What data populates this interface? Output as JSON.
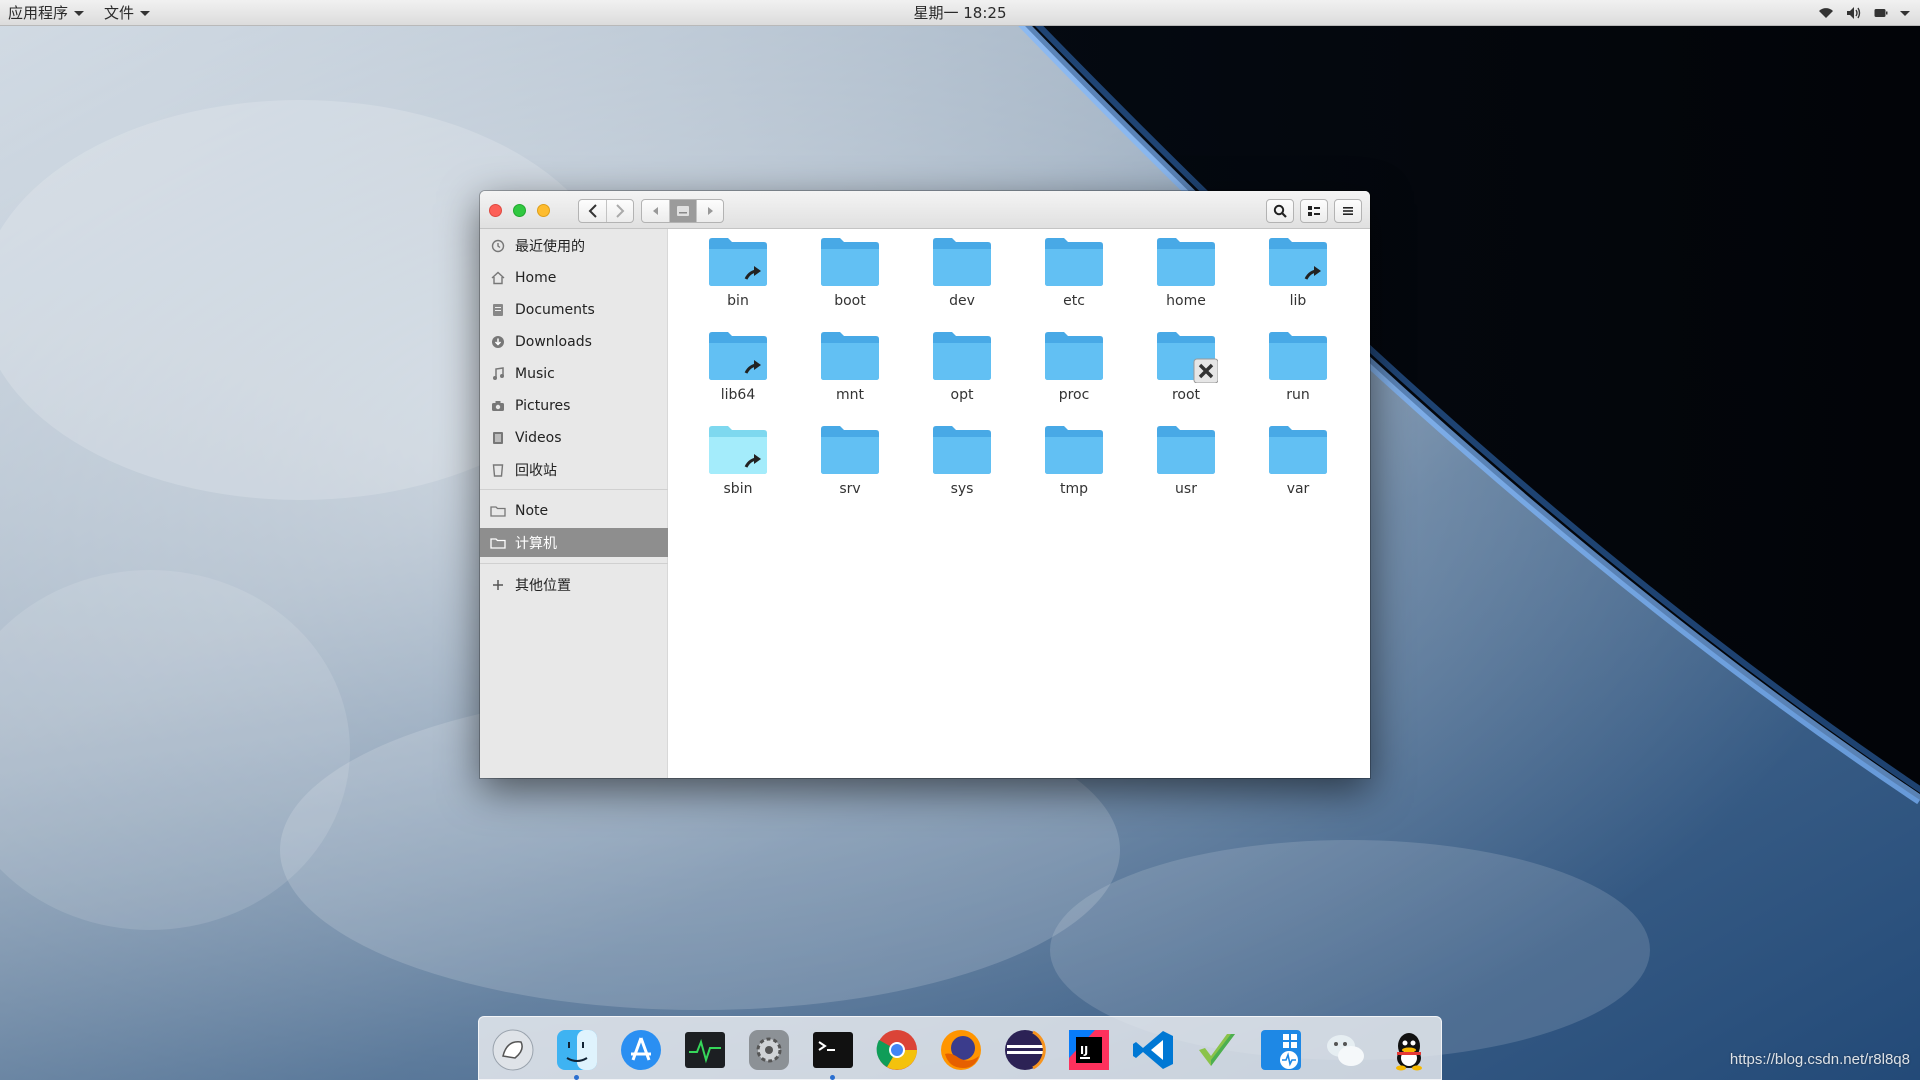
{
  "top_panel": {
    "apps_menu": "应用程序",
    "files_menu": "文件",
    "clock": "星期一 18:25",
    "tray_icons": [
      "wifi-icon",
      "volume-icon",
      "battery-icon",
      "power-icon"
    ]
  },
  "window": {
    "nav_buttons": [
      "back",
      "forward"
    ],
    "path_buttons": [
      "path-left",
      "path-current",
      "path-right"
    ],
    "tool_buttons": [
      "search-icon",
      "view-toggle-icon",
      "hamburger-menu-icon"
    ]
  },
  "sidebar": {
    "items": [
      {
        "label": "最近使用的",
        "icon": "recent-clock-icon"
      },
      {
        "label": "Home",
        "icon": "home-icon"
      },
      {
        "label": "Documents",
        "icon": "documents-icon"
      },
      {
        "label": "Downloads",
        "icon": "downloads-icon"
      },
      {
        "label": "Music",
        "icon": "music-icon"
      },
      {
        "label": "Pictures",
        "icon": "camera-icon"
      },
      {
        "label": "Videos",
        "icon": "film-icon"
      },
      {
        "label": "回收站",
        "icon": "trash-icon"
      },
      {
        "label": "Note",
        "icon": "folder-icon"
      },
      {
        "label": "计算机",
        "icon": "computer-icon",
        "selected": true
      },
      {
        "label": "其他位置",
        "icon": "plus-icon"
      }
    ]
  },
  "files": [
    {
      "name": "bin",
      "badge": "symlink"
    },
    {
      "name": "boot",
      "badge": ""
    },
    {
      "name": "dev",
      "badge": ""
    },
    {
      "name": "etc",
      "badge": ""
    },
    {
      "name": "home",
      "badge": ""
    },
    {
      "name": "lib",
      "badge": "symlink"
    },
    {
      "name": "lib64",
      "badge": "symlink"
    },
    {
      "name": "mnt",
      "badge": ""
    },
    {
      "name": "opt",
      "badge": ""
    },
    {
      "name": "proc",
      "badge": ""
    },
    {
      "name": "root",
      "badge": "no-access"
    },
    {
      "name": "run",
      "badge": ""
    },
    {
      "name": "sbin",
      "badge": "symlink",
      "tint": "light"
    },
    {
      "name": "srv",
      "badge": ""
    },
    {
      "name": "sys",
      "badge": ""
    },
    {
      "name": "tmp",
      "badge": ""
    },
    {
      "name": "usr",
      "badge": ""
    },
    {
      "name": "var",
      "badge": ""
    }
  ],
  "dock": {
    "items": [
      {
        "name": "launcher-icon",
        "running": false
      },
      {
        "name": "finder-icon",
        "running": true
      },
      {
        "name": "app-store-icon",
        "running": false
      },
      {
        "name": "system-monitor-icon",
        "running": false
      },
      {
        "name": "settings-icon",
        "running": false
      },
      {
        "name": "terminal-icon",
        "running": true
      },
      {
        "name": "chrome-icon",
        "running": false
      },
      {
        "name": "firefox-icon",
        "running": false
      },
      {
        "name": "eclipse-icon",
        "running": false
      },
      {
        "name": "intellij-icon",
        "running": false
      },
      {
        "name": "vscode-icon",
        "running": false
      },
      {
        "name": "checkmark-app-icon",
        "running": false
      },
      {
        "name": "multi-os-app-icon",
        "running": false
      },
      {
        "name": "wechat-icon",
        "running": false
      },
      {
        "name": "qq-icon",
        "running": false
      }
    ]
  },
  "watermark": "https://blog.csdn.net/r8l8q8",
  "colors": {
    "folder_blue": "#5ab8f0",
    "folder_light": "#8fe3f7",
    "sidebar_selected": "#8e8e8e"
  }
}
